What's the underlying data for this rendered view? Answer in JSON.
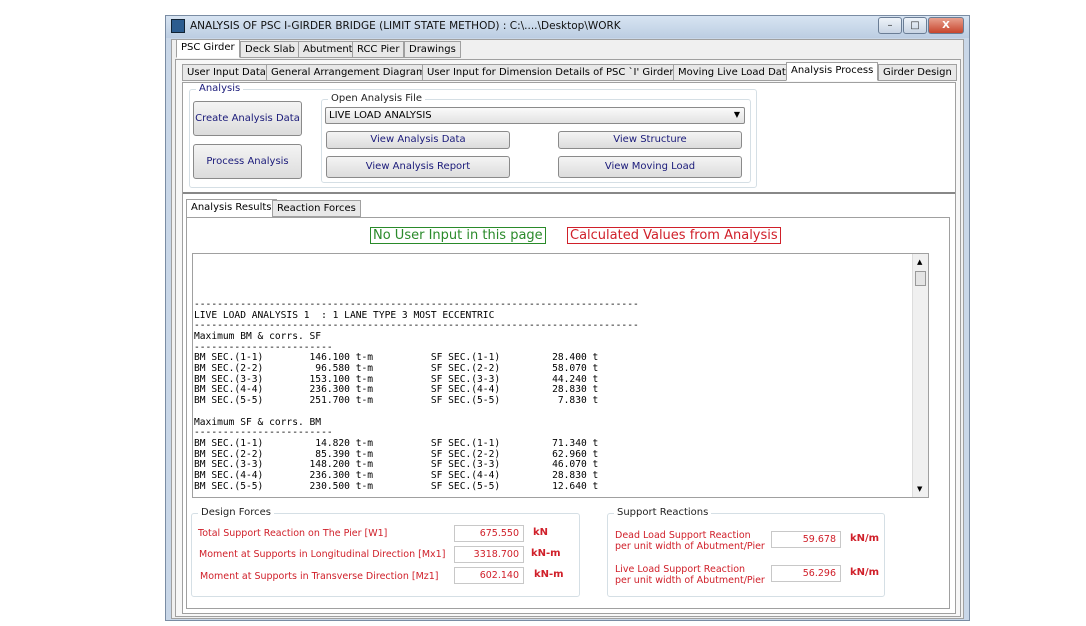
{
  "window": {
    "title": "ANALYSIS OF PSC I-GIRDER BRIDGE (LIMIT STATE METHOD) : C:\\....\\Desktop\\WORK",
    "minimize": "–",
    "maximize": "□",
    "close": "X"
  },
  "main_tabs": [
    "PSC Girder",
    "Deck Slab",
    "Abutment",
    "RCC Pier",
    "Drawings"
  ],
  "sub_tabs": [
    "User Input Data",
    "General Arrangement Diagram",
    "User Input for Dimension Details of PSC `I' Girder",
    "Moving Live Load Data",
    "Analysis Process",
    "Girder Design"
  ],
  "analysis": {
    "group_title": "Analysis",
    "create_button": "Create Analysis Data",
    "process_button": "Process Analysis",
    "open_file": {
      "group_title": "Open Analysis File",
      "selected": "LIVE LOAD ANALYSIS",
      "view_data": "View Analysis Data",
      "view_structure": "View Structure",
      "view_report": "View Analysis Report",
      "view_moving_load": "View Moving Load"
    }
  },
  "result_tabs": [
    "Analysis Results",
    "Reaction Forces"
  ],
  "notices": {
    "no_input": "No User Input in this page",
    "calculated": "Calculated Values from Analysis"
  },
  "output_lines": [
    "",
    "",
    "",
    "",
    "-----------------------------------------------------------------------------",
    "LIVE LOAD ANALYSIS 1  : 1 LANE TYPE 3 MOST ECCENTRIC",
    "-----------------------------------------------------------------------------",
    "Maximum BM & corrs. SF",
    "------------------------",
    "BM SEC.(1-1)        146.100 t-m          SF SEC.(1-1)         28.400 t",
    "BM SEC.(2-2)         96.580 t-m          SF SEC.(2-2)         58.070 t",
    "BM SEC.(3-3)        153.100 t-m          SF SEC.(3-3)         44.240 t",
    "BM SEC.(4-4)        236.300 t-m          SF SEC.(4-4)         28.830 t",
    "BM SEC.(5-5)        251.700 t-m          SF SEC.(5-5)          7.830 t",
    "",
    "Maximum SF & corrs. BM",
    "------------------------",
    "BM SEC.(1-1)         14.820 t-m          SF SEC.(1-1)         71.340 t",
    "BM SEC.(2-2)         85.390 t-m          SF SEC.(2-2)         62.960 t",
    "BM SEC.(3-3)        148.200 t-m          SF SEC.(3-3)         46.070 t",
    "BM SEC.(4-4)        236.300 t-m          SF SEC.(4-4)         28.830 t",
    "BM SEC.(5-5)        230.500 t-m          SF SEC.(5-5)         12.640 t"
  ],
  "design_forces": {
    "title": "Design Forces",
    "rows": [
      {
        "label": "Total Support Reaction on The Pier [W1]",
        "value": "675.550",
        "unit": "kN"
      },
      {
        "label": "Moment at Supports in Longitudinal Direction [Mx1]",
        "value": "3318.700",
        "unit": "kN-m"
      },
      {
        "label": "Moment at Supports in Transverse Direction [Mz1]",
        "value": "602.140",
        "unit": "kN-m"
      }
    ]
  },
  "support_reactions": {
    "title": "Support Reactions",
    "rows": [
      {
        "label1": "Dead Load Support Reaction",
        "label2": "per unit width of Abutment/Pier",
        "value": "59.678",
        "unit": "kN/m"
      },
      {
        "label1": "Live Load Support Reaction",
        "label2": "per unit width of Abutment/Pier",
        "value": "56.296",
        "unit": "kN/m"
      }
    ]
  },
  "colors": {
    "accent_red": "#d0202a",
    "green": "#2a8a2a",
    "button_text": "#1a1a7a"
  }
}
